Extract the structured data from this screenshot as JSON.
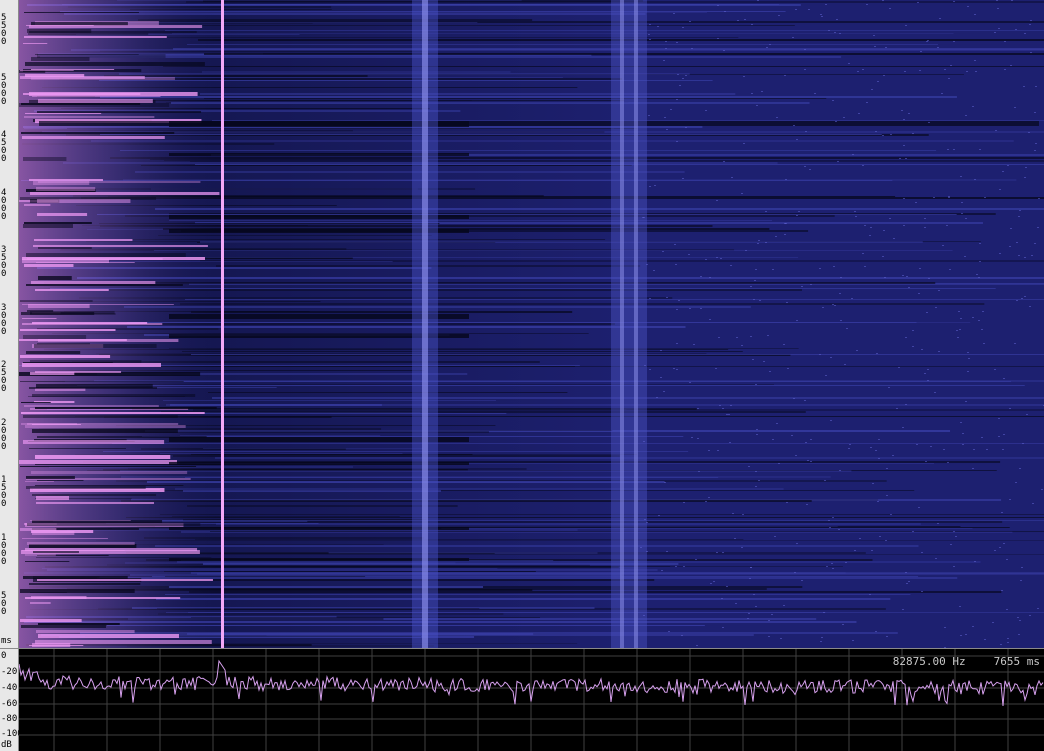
{
  "time_ruler": {
    "unit": "ms",
    "labels": [
      "5\n5\n0\n0",
      "5\n0\n0\n0",
      "4\n5\n0\n0",
      "4\n0\n0\n0",
      "3\n5\n0\n0",
      "3\n0\n0\n0",
      "2\n5\n0\n0",
      "2\n0\n0\n0",
      "1\n5\n0\n0",
      "1\n0\n0\n0",
      "5\n0\n0"
    ]
  },
  "spectrum": {
    "db_labels": [
      "0",
      "-20",
      "-40",
      "-60",
      "-80",
      "-100"
    ],
    "db_unit": "dB",
    "readout_frequency": "82875.00 Hz",
    "readout_time": "7655 ms"
  },
  "colors": {
    "background": "#1c1e6a",
    "bright": "#e88bf0",
    "trace": "#d7a1ee",
    "grid": "#4a4a4a",
    "ruler": "#e8e8e8"
  }
}
